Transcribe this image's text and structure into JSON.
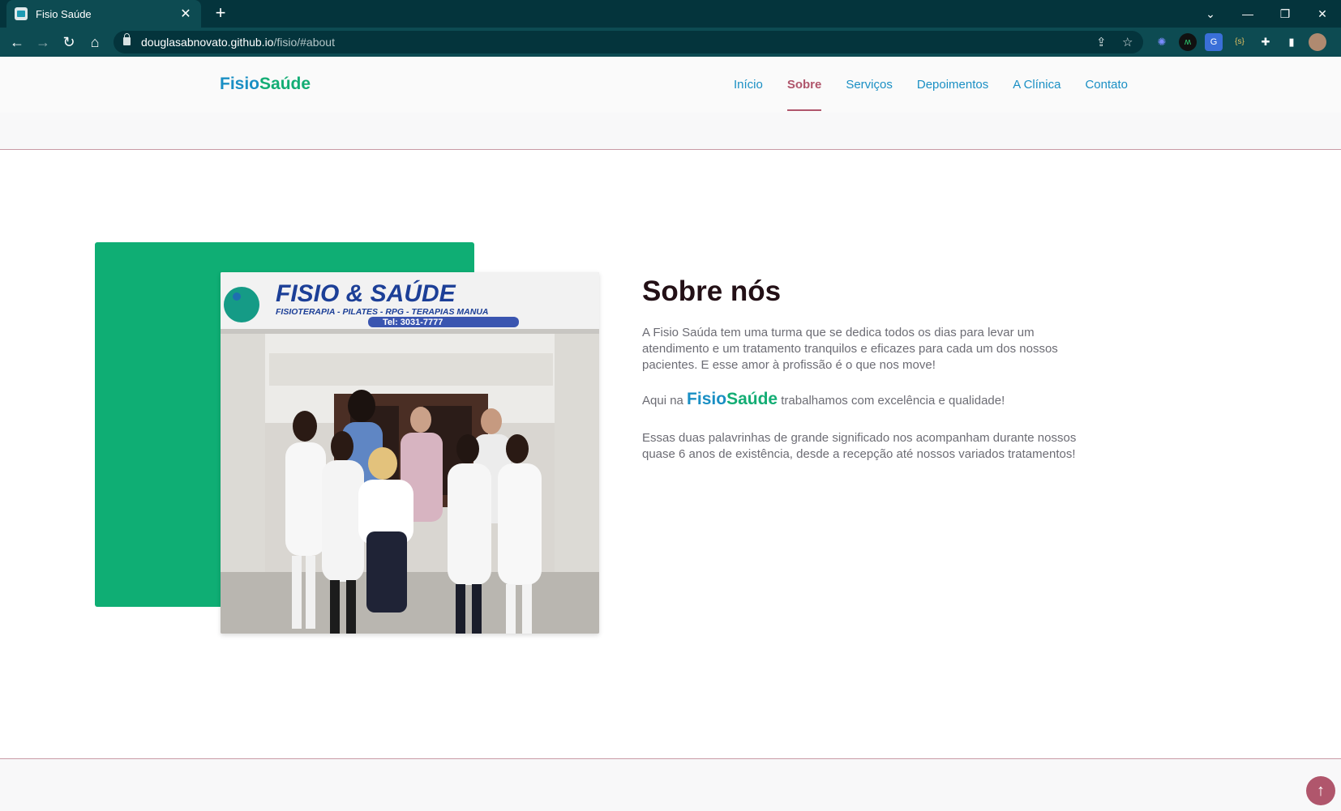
{
  "browser": {
    "tab_title": "Fisio Saúde",
    "tab_close": "✕",
    "new_tab": "+",
    "url_host": "douglasabnovato.github.io",
    "url_path": "/fisio/#about",
    "window_controls": {
      "menu": "⌄",
      "minimize": "—",
      "restore": "❐",
      "close": "✕"
    }
  },
  "site": {
    "logo_part1": "Fisio",
    "logo_part2": "Saúde",
    "nav": [
      {
        "label": "Início",
        "active": false
      },
      {
        "label": "Sobre",
        "active": true
      },
      {
        "label": "Serviços",
        "active": false
      },
      {
        "label": "Depoimentos",
        "active": false
      },
      {
        "label": "A Clínica",
        "active": false
      },
      {
        "label": "Contato",
        "active": false
      }
    ]
  },
  "about": {
    "title": "Sobre nós",
    "paragraph1": "A Fisio Saúda tem uma turma que se dedica todos os dias para levar um atendimento e um tratamento tranquilos e eficazes para cada um dos nossos pacientes. E esse amor à profissão é o que nos move!",
    "paragraph2_prefix": "Aqui na ",
    "paragraph2_logo1": "Fisio",
    "paragraph2_logo2": "Saúde",
    "paragraph2_suffix": " trabalhamos com excelência e qualidade!",
    "paragraph3": "Essas duas palavrinhas de grande significado nos acompanham durante nossos quase 6 anos de existência, desde a recepção até nossos variados tratamentos!",
    "photo_sign_title": "FISIO & SAÚDE",
    "photo_sign_subtitle": "FISIOTERAPIA - PILATES - RPG - TERAPIAS MANUA",
    "photo_sign_phone": "Tel: 3031-7777"
  },
  "back_to_top": "↑",
  "colors": {
    "brand_blue": "#1a8fc4",
    "brand_green": "#13ad74",
    "accent": "#b0566c",
    "chrome": "#0d4b52"
  }
}
